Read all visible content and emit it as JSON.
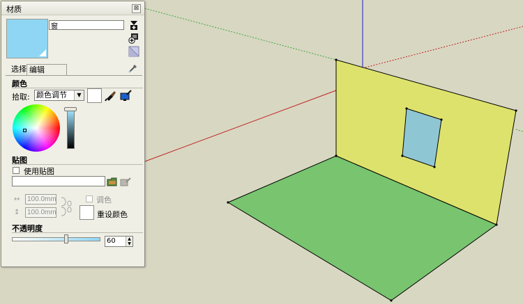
{
  "panel": {
    "title": "材质",
    "close_glyph": "⊠",
    "material_name": "窗",
    "tabs": {
      "select": "选择",
      "edit": "编辑"
    },
    "color": {
      "heading": "颜色",
      "pick_label": "拾取:",
      "picker_value": "颜色调节"
    },
    "texture": {
      "heading": "贴图",
      "use_texture_label": "使用贴图",
      "width_value": "100.0mm",
      "height_value": "100.0mm",
      "colorize_label": "调色",
      "reset_color_label": "重设颜色"
    },
    "opacity": {
      "heading": "不透明度",
      "value": "60",
      "fraction": 0.6
    }
  },
  "icons": [
    "close-icon",
    "create-material-icon",
    "add-to-model-icon",
    "default-material-icon",
    "eyedropper-icon",
    "sample-paint-icon",
    "match-screen-color-icon",
    "browse-texture-icon",
    "edit-texture-icon",
    "link-aspect-icon",
    "width-arrow-icon",
    "height-arrow-icon"
  ],
  "colors": {
    "background": "#d8d7c2",
    "material_swatch": "#8fd6f4",
    "wall": "#dde26c",
    "floor": "#78c46f",
    "window": "#8fc6d4",
    "red_axis": "#c02020",
    "green_axis": "#3aa63a",
    "blue_axis": "#1a1acc"
  }
}
